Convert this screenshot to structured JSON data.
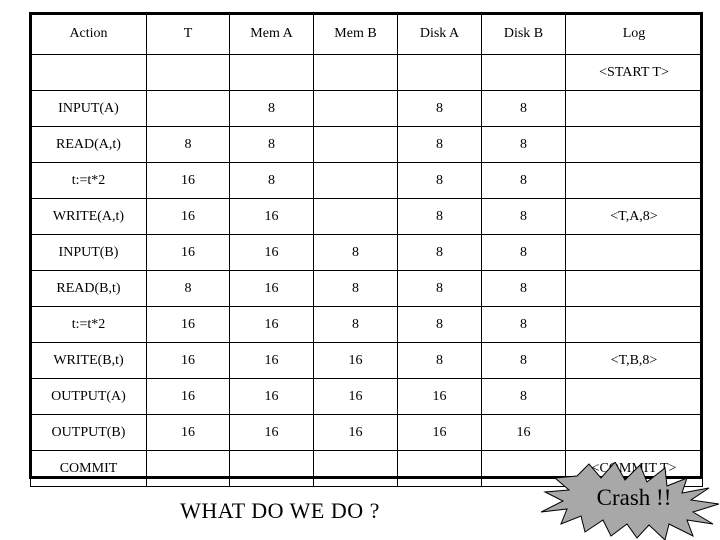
{
  "table": {
    "columns": [
      "Action",
      "T",
      "Mem A",
      "Mem B",
      "Disk A",
      "Disk B",
      "Log"
    ],
    "rows": [
      {
        "action": "",
        "t": "",
        "mem_a": "",
        "mem_b": "",
        "disk_a": "",
        "disk_b": "",
        "log": "<START T>"
      },
      {
        "action": "INPUT(A)",
        "t": "",
        "mem_a": "8",
        "mem_b": "",
        "disk_a": "8",
        "disk_b": "8",
        "log": ""
      },
      {
        "action": "READ(A,t)",
        "t": "8",
        "mem_a": "8",
        "mem_b": "",
        "disk_a": "8",
        "disk_b": "8",
        "log": ""
      },
      {
        "action": "t:=t*2",
        "t": "16",
        "mem_a": "8",
        "mem_b": "",
        "disk_a": "8",
        "disk_b": "8",
        "log": ""
      },
      {
        "action": "WRITE(A,t)",
        "t": "16",
        "mem_a": "16",
        "mem_b": "",
        "disk_a": "8",
        "disk_b": "8",
        "log": "<T,A,8>"
      },
      {
        "action": "INPUT(B)",
        "t": "16",
        "mem_a": "16",
        "mem_b": "8",
        "disk_a": "8",
        "disk_b": "8",
        "log": ""
      },
      {
        "action": "READ(B,t)",
        "t": "8",
        "mem_a": "16",
        "mem_b": "8",
        "disk_a": "8",
        "disk_b": "8",
        "log": ""
      },
      {
        "action": "t:=t*2",
        "t": "16",
        "mem_a": "16",
        "mem_b": "8",
        "disk_a": "8",
        "disk_b": "8",
        "log": ""
      },
      {
        "action": "WRITE(B,t)",
        "t": "16",
        "mem_a": "16",
        "mem_b": "16",
        "disk_a": "8",
        "disk_b": "8",
        "log": "<T,B,8>"
      },
      {
        "action": "OUTPUT(A)",
        "t": "16",
        "mem_a": "16",
        "mem_b": "16",
        "disk_a": "16",
        "disk_b": "8",
        "log": ""
      },
      {
        "action": "OUTPUT(B)",
        "t": "16",
        "mem_a": "16",
        "mem_b": "16",
        "disk_a": "16",
        "disk_b": "16",
        "log": ""
      },
      {
        "action": "COMMIT",
        "t": "",
        "mem_a": "",
        "mem_b": "",
        "disk_a": "",
        "disk_b": "",
        "log": "<COMMIT T>"
      }
    ]
  },
  "caption": "WHAT DO WE DO ?",
  "crash": {
    "label": "Crash !!",
    "fill_color": "#a8a8a8",
    "stroke_color": "#000000"
  }
}
